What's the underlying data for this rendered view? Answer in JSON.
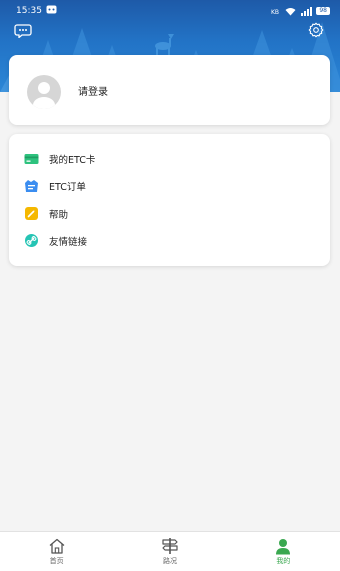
{
  "status_bar": {
    "time": "15:35",
    "battery": "98"
  },
  "profile": {
    "login_prompt": "请登录"
  },
  "menu": {
    "items": [
      {
        "label": "我的ETC卡",
        "icon": "card-icon",
        "color": "#2ec27e"
      },
      {
        "label": "ETC订单",
        "icon": "order-icon",
        "color": "#3b8df0"
      },
      {
        "label": "帮助",
        "icon": "help-icon",
        "color": "#f5b800"
      },
      {
        "label": "友情链接",
        "icon": "link-icon",
        "color": "#25c4b4"
      }
    ]
  },
  "bottom_nav": {
    "tabs": [
      {
        "label": "首页",
        "icon": "home-icon",
        "active": false
      },
      {
        "label": "路况",
        "icon": "road-sign-icon",
        "active": false
      },
      {
        "label": "我的",
        "icon": "person-icon",
        "active": true
      }
    ]
  },
  "colors": {
    "header": "#2273c6",
    "active_tab": "#3aa850",
    "background": "#f4f4f4"
  }
}
